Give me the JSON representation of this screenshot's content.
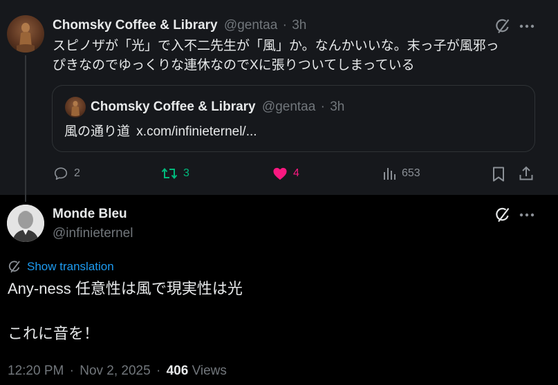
{
  "parent_tweet": {
    "author_name": "Chomsky Coffee & Library",
    "handle": "@gentaa",
    "separator": "·",
    "time": "3h",
    "text_line1": "スピノザが「光」で入不二先生が「風」か。なんかいいな。末っ子が風邪っ",
    "text_line2": "ぴきなのでゆっくりな連休なのでXに張りついてしまっている",
    "quote": {
      "author_name": "Chomsky Coffee & Library",
      "handle": "@gentaa",
      "separator": "·",
      "time": "3h",
      "text_prefix": "風の通り道",
      "link_text": "x.com/infinieternel/..."
    },
    "actions": {
      "replies": "2",
      "reposts": "3",
      "likes": "4",
      "views": "653"
    }
  },
  "main_tweet": {
    "author_name": "Monde Bleu",
    "handle": "@infinieternel",
    "show_translation": "Show translation",
    "text_line1": "Any-ness 任意性は風で現実性は光",
    "text_line2": "これに音を！",
    "footer": {
      "time": "12:20 PM",
      "dot1": "·",
      "date": "Nov 2, 2025",
      "dot2": "·",
      "views_count": "406",
      "views_label": "Views"
    }
  },
  "colors": {
    "background": "#000000",
    "parent_background": "#16181c",
    "text_primary": "#e7e9ea",
    "text_muted": "#71767b",
    "link": "#1d9bf0",
    "repost_active": "#00ba7c",
    "like_active": "#f91880",
    "border": "#2f3336"
  },
  "icons": [
    "grok-icon",
    "more-icon",
    "reply-icon",
    "repost-icon",
    "heart-icon",
    "views-icon",
    "bookmark-icon",
    "share-icon",
    "translate-icon"
  ]
}
